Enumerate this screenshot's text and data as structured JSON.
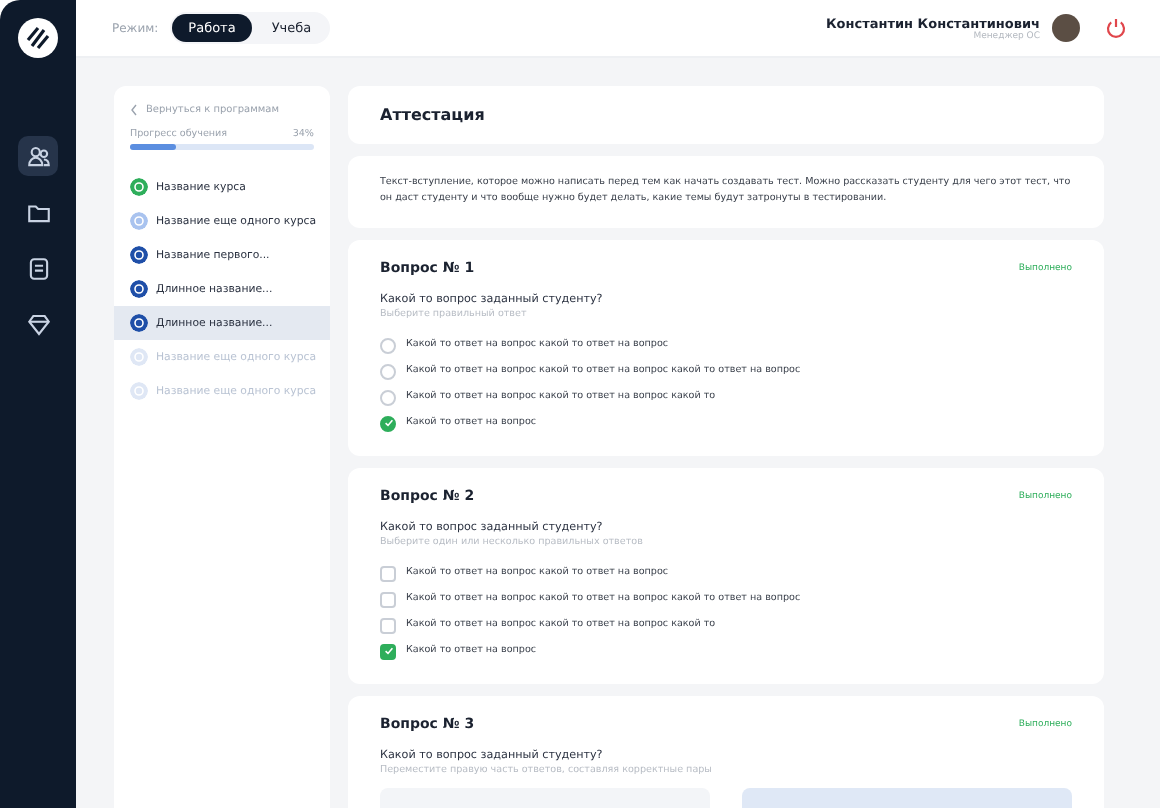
{
  "mode": {
    "label": "Режим:",
    "options": [
      {
        "label": "Работа",
        "selected": true
      },
      {
        "label": "Учеба",
        "selected": false
      }
    ]
  },
  "user": {
    "name": "Константин Константинович",
    "role": "Менеджер ОС"
  },
  "nav": [
    {
      "kind": "users",
      "selected": true
    },
    {
      "kind": "folder",
      "selected": false
    },
    {
      "kind": "document",
      "selected": false
    },
    {
      "kind": "diamond",
      "selected": false
    }
  ],
  "sidebar": {
    "back": "Вернуться к программам",
    "progress_label": "Прогресс обучения",
    "progress_value": "34%",
    "level": 0.25,
    "items": [
      {
        "label": "Название курса",
        "kind": "done",
        "selected": false
      },
      {
        "label": "Название еще одного курса",
        "kind": "available",
        "selected": false
      },
      {
        "label": "Название первого...",
        "kind": "current",
        "selected": false
      },
      {
        "label": "Длинное название...",
        "kind": "current",
        "selected": false
      },
      {
        "label": "Длинное название...",
        "kind": "current",
        "selected": true
      },
      {
        "label": "Название еще одного курса",
        "kind": "locked",
        "selected": false
      },
      {
        "label": "Название еще одного курса",
        "kind": "locked",
        "selected": false
      }
    ]
  },
  "page_title": "Аттестация",
  "intro": "Текст-вступление, которое можно написать перед тем как начать создавать тест. Можно рассказать студенту для чего этот тест, что он даст студенту и что вообще нужно будет делать, какие темы будут затронуты в тестировании.",
  "questions": [
    {
      "title": "Вопрос № 1",
      "status": "Выполнено",
      "question": "Какой то вопрос заданный студенту?",
      "hint": "Выберите правильный ответ",
      "kind": "radio",
      "options": [
        {
          "label": "Какой то ответ на вопрос какой то ответ на вопрос",
          "checked": false
        },
        {
          "label": "Какой то ответ на вопрос какой то ответ на вопрос какой то ответ на вопрос",
          "checked": false
        },
        {
          "label": "Какой то ответ на вопрос какой то ответ на вопрос какой то",
          "checked": false
        },
        {
          "label": "Какой то ответ на вопрос",
          "checked": true
        }
      ]
    },
    {
      "title": "Вопрос № 2",
      "status": "Выполнено",
      "question": "Какой то вопрос заданный студенту?",
      "hint": "Выберите один или несколько правильных ответов",
      "kind": "checkbox",
      "options": [
        {
          "label": "Какой то ответ на вопрос какой то ответ на вопрос",
          "checked": false
        },
        {
          "label": "Какой то ответ на вопрос какой то ответ на вопрос какой то ответ на вопрос",
          "checked": false
        },
        {
          "label": "Какой то ответ на вопрос какой то ответ на вопрос какой то",
          "checked": false
        },
        {
          "label": "Какой то ответ на вопрос",
          "checked": true
        }
      ]
    },
    {
      "title": "Вопрос № 3",
      "status": "Выполнено",
      "question": "Какой то вопрос заданный студенту?",
      "hint": "Переместите правую часть ответов, составляя корректные пары",
      "kind": "match"
    }
  ]
}
